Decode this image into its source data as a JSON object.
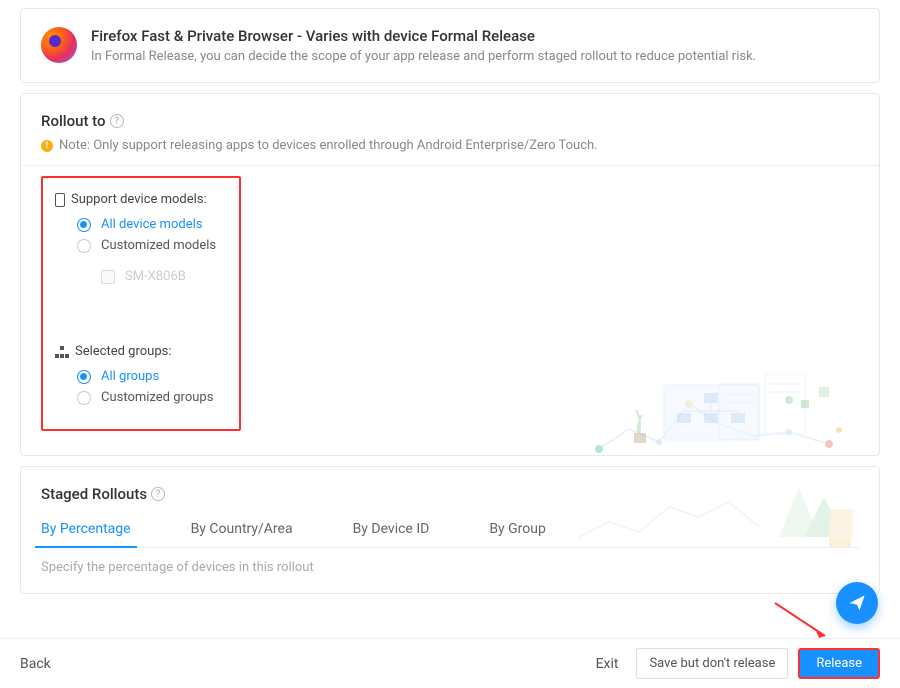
{
  "header": {
    "title": "Firefox Fast & Private Browser - Varies with device Formal Release",
    "subtitle": "In Formal Release, you can decide the scope of your app release and perform staged rollout to reduce potential risk."
  },
  "rollout": {
    "title": "Rollout to",
    "note": "Note: Only support releasing apps to devices enrolled through Android Enterprise/Zero Touch.",
    "device_models": {
      "heading": "Support device models:",
      "options": {
        "all": "All device models",
        "custom": "Customized models"
      },
      "item": "SM-X806B"
    },
    "groups": {
      "heading": "Selected groups:",
      "options": {
        "all": "All groups",
        "custom": "Customized groups"
      }
    }
  },
  "staged": {
    "title": "Staged Rollouts",
    "tabs": {
      "percentage": "By Percentage",
      "country": "By Country/Area",
      "device": "By Device ID",
      "group": "By Group"
    },
    "desc": "Specify the percentage of devices in this rollout"
  },
  "footer": {
    "back": "Back",
    "exit": "Exit",
    "save": "Save but don't release",
    "release": "Release"
  }
}
